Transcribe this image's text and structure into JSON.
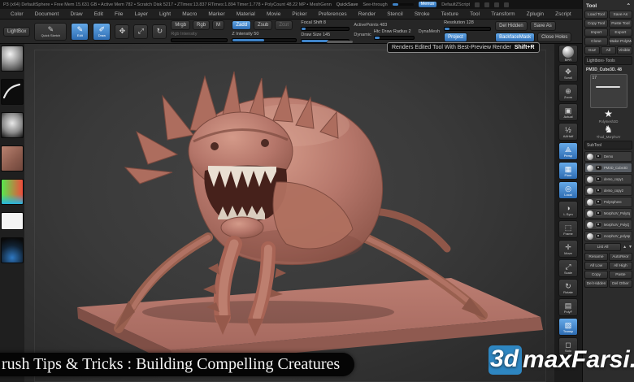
{
  "titlebar": {
    "info": "P3 (x64) DefaultSphere  •  Free Mem 15.631 GB  •  Active Mem 782  •  Scratch Disk 5217  •  ZTimes:13.837  RTimes:1.894  Timer:1.778  •  PolyCount 48.22 MP  •  MeshGenn",
    "quicksave": "QuickSave",
    "see_through": "See-through",
    "menus_button": "Menus",
    "zscript": "DefaultZScript"
  },
  "menubar": {
    "items": [
      "Color",
      "Document",
      "Draw",
      "Edit",
      "File",
      "Layer",
      "Light",
      "Macro",
      "Marker",
      "Material",
      "Movie",
      "Picker",
      "Preferences",
      "Render",
      "Stencil",
      "Stroke",
      "Texture",
      "Tool",
      "Transform",
      "Zplugin",
      "Zscript"
    ]
  },
  "shelf": {
    "lightbox": "LightBox",
    "quick_sketch": "Quick Sketch",
    "edit": "Edit",
    "draw": "Draw",
    "mrgb": "Mrgb",
    "rgb": "Rgb",
    "m": "M",
    "rgb_intensity": "Rgb Intensity",
    "zadd": "Zadd",
    "zsub": "Zsub",
    "zcut": "Zcut",
    "z_intensity": "Z Intensity 50",
    "focal_shift": "Focal Shift 8",
    "draw_size": "Draw Size 145",
    "active_points": "ActivePoints 483",
    "dynamic": "Dynamic",
    "htc_radius": "Htc Draw Radius 2",
    "dynamesh": "DynaMesh",
    "resolution": "Resolution 128",
    "project": "Project",
    "del_hidden": "Del Hidden",
    "save_as": "Save As",
    "backface_mask": "BackfaceMask",
    "close_holes": "Close Holes"
  },
  "tooltip": {
    "text": "Renders Edited Tool With Best-Preview Render",
    "shortcut": "Shift+R"
  },
  "right_shelf": {
    "items": [
      {
        "icon": "bpr-render-icon",
        "glyph": "",
        "label": "BPR",
        "cls": "sphere"
      },
      {
        "icon": "scroll-icon",
        "glyph": "✥",
        "label": "Scroll",
        "cls": ""
      },
      {
        "icon": "zoom-icon",
        "glyph": "⊕",
        "label": "Zoom",
        "cls": ""
      },
      {
        "icon": "actual-size-icon",
        "glyph": "▣",
        "label": "Actual",
        "cls": ""
      },
      {
        "icon": "aahalf-icon",
        "glyph": "½",
        "label": "AAHalf",
        "cls": ""
      },
      {
        "icon": "perspective-icon",
        "glyph": "⟁",
        "label": "Persp",
        "cls": "active"
      },
      {
        "icon": "floor-grid-icon",
        "glyph": "▦",
        "label": "Floor",
        "cls": "active"
      },
      {
        "icon": "local-pivot-icon",
        "glyph": "◎",
        "label": "Local",
        "cls": "active"
      },
      {
        "icon": "lsym-icon",
        "glyph": "◑",
        "label": "L.Sym",
        "cls": ""
      },
      {
        "icon": "frame-icon",
        "glyph": "⬚",
        "label": "Frame",
        "cls": ""
      },
      {
        "icon": "move-icon",
        "glyph": "✛",
        "label": "Move",
        "cls": ""
      },
      {
        "icon": "scale-icon",
        "glyph": "⤢",
        "label": "Scale",
        "cls": ""
      },
      {
        "icon": "rotate-icon",
        "glyph": "↻",
        "label": "Rotate",
        "cls": ""
      },
      {
        "icon": "polyframe-icon",
        "glyph": "▤",
        "label": "PolyF",
        "cls": ""
      },
      {
        "icon": "transparency-icon",
        "glyph": "▧",
        "label": "Transp",
        "cls": "active"
      },
      {
        "icon": "solo-icon",
        "glyph": "◻",
        "label": "Solo",
        "cls": ""
      }
    ]
  },
  "tool_panel": {
    "header": "Tool",
    "collapse_glyph": "⌃",
    "buttons": [
      {
        "id": "load-tool-button",
        "label": "Load Tool",
        "w": "half"
      },
      {
        "id": "save-as-tool-button",
        "label": "Save As",
        "w": "half"
      },
      {
        "id": "copy-tool-button",
        "label": "Copy Tool",
        "w": "half"
      },
      {
        "id": "paste-tool-button",
        "label": "Paste Tool",
        "w": "half"
      },
      {
        "id": "import-button",
        "label": "Import",
        "w": "half"
      },
      {
        "id": "export-button",
        "label": "Export",
        "w": "half"
      },
      {
        "id": "clone-button",
        "label": "Clone",
        "w": "half"
      },
      {
        "id": "make-polymesh-button",
        "label": "Make PolyMe",
        "w": "half"
      },
      {
        "id": "goz-button",
        "label": "GoZ",
        "w": "third"
      },
      {
        "id": "goz-all-button",
        "label": "All",
        "w": "third"
      },
      {
        "id": "goz-visible-button",
        "label": "Visible",
        "w": "third"
      }
    ],
    "lightbox_tools": "Lightbox» Tools",
    "current_tool": "PM3D_Cube3D. 48",
    "preview_value": "17",
    "polymesh_star": "Polymesh3D",
    "star_glyph": "★",
    "morph_tool": "Thud_MorphUV",
    "morph_glyph": "♞",
    "subtool_header": "SubTool",
    "subtools": [
      {
        "name": "Demo",
        "state": ""
      },
      {
        "name": "PM3D_Cube3D",
        "state": "selected"
      },
      {
        "name": "demo_copy1",
        "state": ""
      },
      {
        "name": "demo_copy2",
        "state": ""
      },
      {
        "name": "PolySphere",
        "state": ""
      },
      {
        "name": "MorphUV_PolySp",
        "state": ""
      },
      {
        "name": "MorphUV_PolyQ",
        "state": ""
      },
      {
        "name": "morphUV_polysphere",
        "state": ""
      }
    ],
    "list_all": "List All",
    "arrows_up": "▲",
    "arrows_down": "▼",
    "bottom_buttons": [
      {
        "id": "rename-button",
        "label": "Rename",
        "w": "half"
      },
      {
        "id": "autoreorder-button",
        "label": "AutoReor",
        "w": "half"
      },
      {
        "id": "all-low-button",
        "label": "All Low",
        "w": "half"
      },
      {
        "id": "all-high-button",
        "label": "All High",
        "w": "half"
      },
      {
        "id": "copy-subtool-button",
        "label": "Copy",
        "w": "half"
      },
      {
        "id": "paste-subtool-button",
        "label": "Paste",
        "w": "half"
      },
      {
        "id": "del-hidden-button",
        "label": "Del Hidden",
        "w": "half"
      },
      {
        "id": "del-other-button",
        "label": "Del Other",
        "w": "half"
      }
    ]
  },
  "caption": "rush Tips & Tricks : Building Compelling Creatures",
  "watermark": {
    "prefix": "3d",
    "rest": "maxFarsi.ir"
  },
  "colors": {
    "accent": "#4a8fd4",
    "clay": "#b5766a",
    "platform": "#b2746a",
    "watermark_blue": "#2e86c1"
  }
}
